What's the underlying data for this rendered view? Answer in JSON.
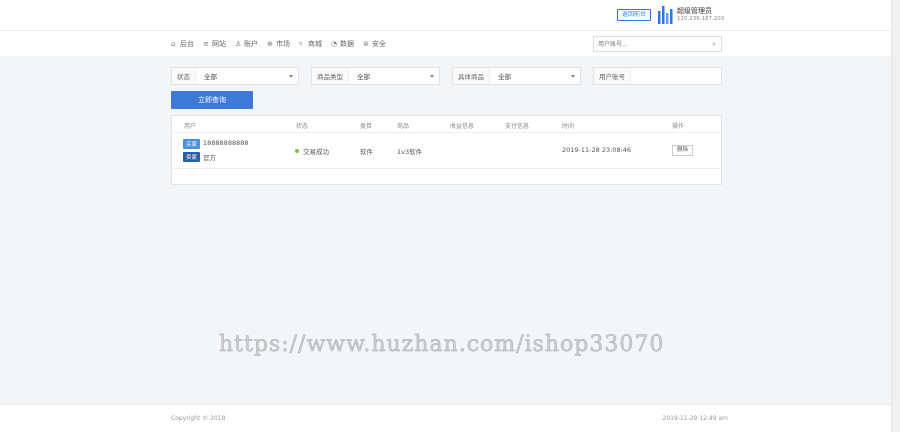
{
  "header": {
    "tag_button": "返回前台",
    "brand_title": "超级管理员",
    "brand_sub": "120.236.187.203"
  },
  "nav": {
    "items": [
      {
        "icon": "home-icon",
        "glyph": "⌂",
        "label": "后台"
      },
      {
        "icon": "list-icon",
        "glyph": "≡",
        "label": "网站"
      },
      {
        "icon": "user-icon",
        "glyph": "♙",
        "label": "账户"
      },
      {
        "icon": "globe-icon",
        "glyph": "⊕",
        "label": "市场"
      },
      {
        "icon": "cart-icon",
        "glyph": "▿",
        "label": "商城"
      },
      {
        "icon": "chart-icon",
        "glyph": "◔",
        "label": "数据"
      },
      {
        "icon": "settings-icon",
        "glyph": "⊛",
        "label": "安全"
      }
    ],
    "search_placeholder": "用户账号..."
  },
  "filters": {
    "status": {
      "label": "状态",
      "value": "全部"
    },
    "product_type": {
      "label": "商品类型",
      "value": "全部"
    },
    "specific_product": {
      "label": "具体商品",
      "value": "全部"
    },
    "user_account": {
      "label": "用户账号",
      "value": ""
    }
  },
  "query_button": "立即查询",
  "table": {
    "columns": [
      "用户",
      "状态",
      "类目",
      "商品",
      "收益信息",
      "支付信息",
      "时间",
      "操作"
    ],
    "rows": [
      {
        "badge_buy": "买家",
        "account": "18888888888",
        "badge_sell": "卖家",
        "seller": "官方",
        "status": "交易成功",
        "category": "软件",
        "product": "1v3软件",
        "income": "",
        "payment": "",
        "time": "2019-11-28 23:08:46",
        "action": "删除"
      }
    ]
  },
  "watermark": "https://www.huzhan.com/ishop33070",
  "footer": {
    "copyright": "Copyright © 2018",
    "time": "2019-11-29 12:49 am"
  },
  "colors": {
    "accent": "#3d7ad7",
    "success_dot": "#7ac142",
    "background": "#f4f5f9"
  }
}
